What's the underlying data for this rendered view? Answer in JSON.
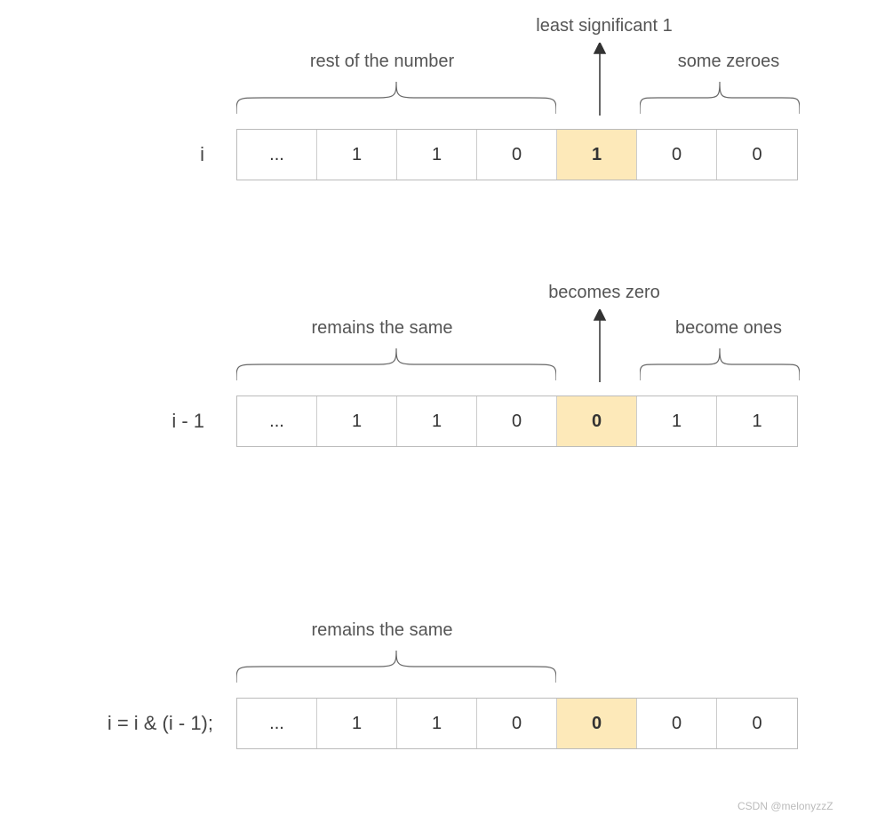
{
  "rows": [
    {
      "label": "i",
      "cells": [
        "...",
        "1",
        "1",
        "0",
        "1",
        "0",
        "0"
      ],
      "highlight_index": 4,
      "annotations": {
        "left_brace": "rest of the number",
        "arrow": "least significant 1",
        "right_brace": "some zeroes"
      }
    },
    {
      "label": "i - 1",
      "cells": [
        "...",
        "1",
        "1",
        "0",
        "0",
        "1",
        "1"
      ],
      "highlight_index": 4,
      "annotations": {
        "left_brace": "remains the same",
        "arrow": "becomes zero",
        "right_brace": "become ones"
      }
    },
    {
      "label": "i = i & (i - 1);",
      "cells": [
        "...",
        "1",
        "1",
        "0",
        "0",
        "0",
        "0"
      ],
      "highlight_index": 4,
      "annotations": {
        "left_brace": "remains the same"
      }
    }
  ],
  "watermark": "CSDN @melonyzzZ"
}
